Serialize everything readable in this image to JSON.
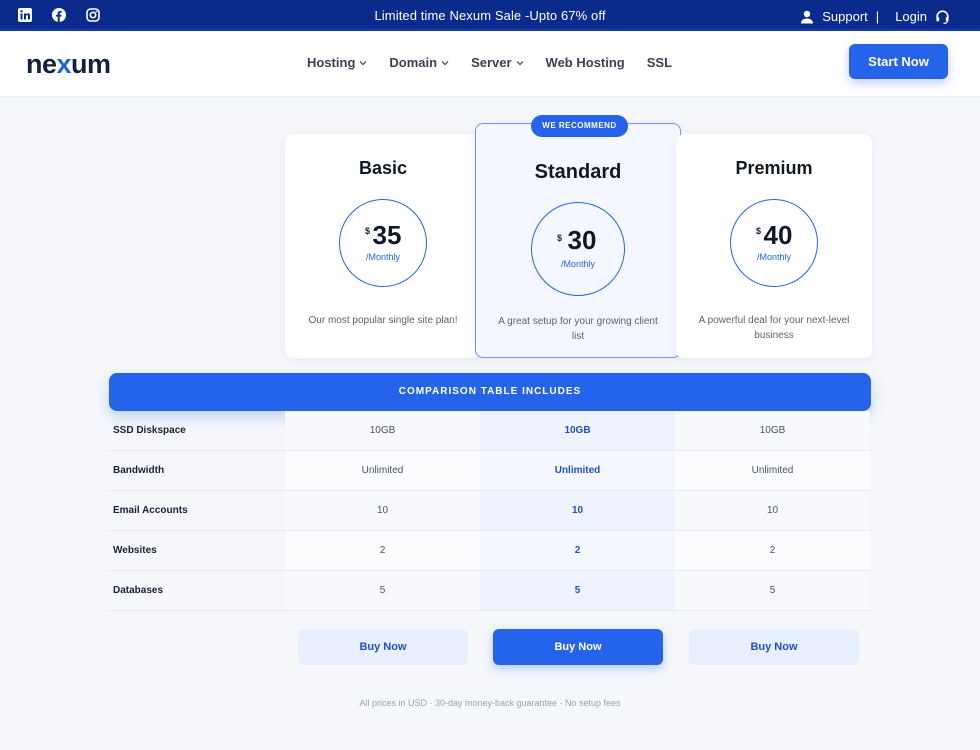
{
  "topbar": {
    "socials": [
      "linkedin-icon",
      "facebook-icon",
      "instagram-icon"
    ],
    "promo": "Limited time Nexum Sale -Upto 67% off",
    "support_label": "Support",
    "separator": "|",
    "login_label": "Login"
  },
  "nav": {
    "logo_text_start": "ne",
    "logo_text_accent": "x",
    "logo_text_end": "um",
    "items": [
      {
        "label": "Hosting",
        "dropdown": true
      },
      {
        "label": "Domain",
        "dropdown": true
      },
      {
        "label": "Server",
        "dropdown": true
      },
      {
        "label": "Web Hosting",
        "dropdown": false
      },
      {
        "label": "SSL",
        "dropdown": false
      }
    ],
    "cta_label": "Start Now"
  },
  "plans": [
    {
      "name": "Basic",
      "currency": "$",
      "price": "35",
      "period": "/Monthly",
      "description": "Our most popular single site plan!"
    },
    {
      "name": "Standard",
      "badge": "WE RECOMMEND",
      "currency": "$",
      "price": "30",
      "period": "/Monthly",
      "description": "A great setup for your growing client list"
    },
    {
      "name": "Premium",
      "currency": "$",
      "price": "40",
      "period": "/Monthly",
      "description": "A powerful deal for your next-level business"
    }
  ],
  "comparison": {
    "title": "COMPARISON TABLE INCLUDES",
    "rows": [
      {
        "feature": "SSD Diskspace",
        "values": [
          "10GB",
          "10GB",
          "10GB"
        ]
      },
      {
        "feature": "Bandwidth",
        "values": [
          "Unlimited",
          "Unlimited",
          "Unlimited"
        ]
      },
      {
        "feature": "Email Accounts",
        "values": [
          "10",
          "10",
          "10"
        ]
      },
      {
        "feature": "Websites",
        "values": [
          "2",
          "2",
          "2"
        ]
      },
      {
        "feature": "Databases",
        "values": [
          "5",
          "5",
          "5"
        ]
      }
    ]
  },
  "buy_labels": [
    "Buy Now",
    "Buy Now",
    "Buy Now"
  ],
  "footnote": "All prices in USD · 30-day money-back guarantee · No setup fees",
  "colors": {
    "primary": "#2563eb",
    "topbar": "#0a2a8c",
    "text": "#1a1f36"
  }
}
